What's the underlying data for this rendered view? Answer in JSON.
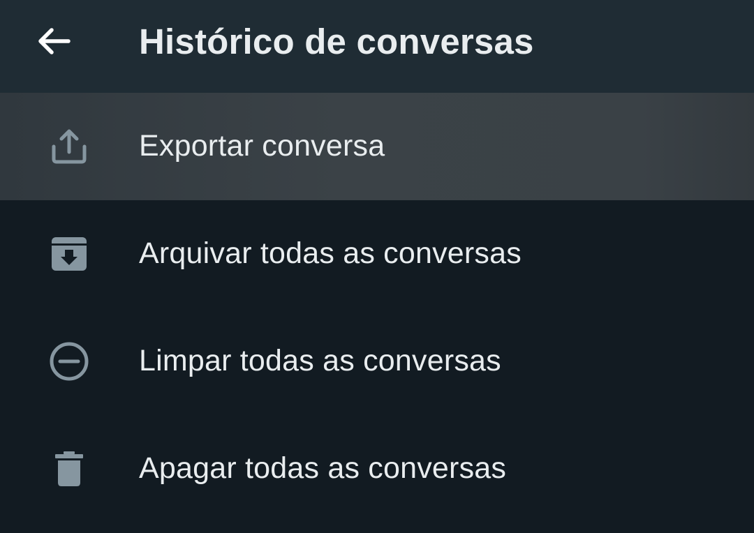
{
  "header": {
    "title": "Histórico de conversas",
    "back_icon": "arrow-left-icon"
  },
  "menu": {
    "items": [
      {
        "label": "Exportar conversa",
        "icon": "export-icon",
        "highlighted": true
      },
      {
        "label": "Arquivar todas as conversas",
        "icon": "archive-icon",
        "highlighted": false
      },
      {
        "label": "Limpar todas as conversas",
        "icon": "clear-icon",
        "highlighted": false
      },
      {
        "label": "Apagar todas as conversas",
        "icon": "delete-icon",
        "highlighted": false
      }
    ]
  },
  "colors": {
    "background": "#121b22",
    "app_bar": "#1f2c34",
    "text": "#e9edef",
    "icon": "#8696a0",
    "highlight": "#3b4247"
  }
}
